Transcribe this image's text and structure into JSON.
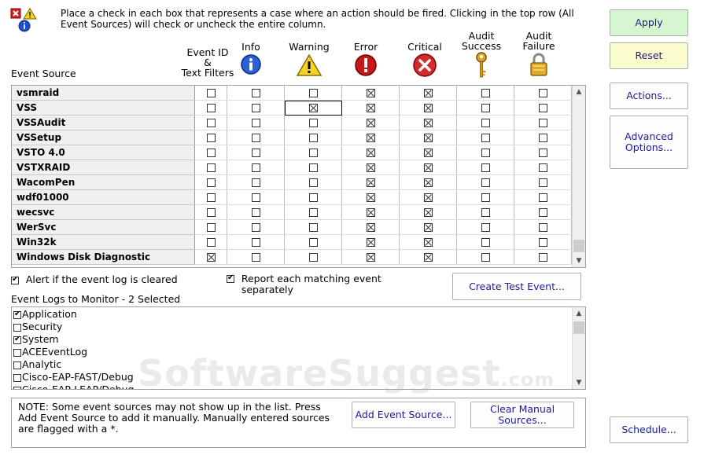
{
  "instruction": "Place a check in each box that represents a case where an action should be fired. Clicking in the top row (All Event Sources) will check or uncheck the entire column.",
  "event_source_label": "Event Source",
  "columns": [
    {
      "name": "Event ID & Text Filters",
      "line1": "Event ID",
      "line2": "&",
      "line3": "Text Filters",
      "icon": "none"
    },
    {
      "name": "Info",
      "icon": "info-icon"
    },
    {
      "name": "Warning",
      "icon": "warning-icon"
    },
    {
      "name": "Error",
      "icon": "error-icon"
    },
    {
      "name": "Critical",
      "icon": "critical-icon"
    },
    {
      "name": "Audit Success",
      "line1": "Audit",
      "line2": "Success",
      "icon": "key-icon"
    },
    {
      "name": "Audit Failure",
      "line1": "Audit",
      "line2": "Failure",
      "icon": "lock-icon"
    }
  ],
  "rows": [
    {
      "source": "vsmraid",
      "checks": [
        false,
        false,
        false,
        true,
        true,
        false,
        false
      ]
    },
    {
      "source": "VSS",
      "checks": [
        false,
        false,
        true,
        true,
        true,
        false,
        false
      ]
    },
    {
      "source": "VSSAudit",
      "checks": [
        false,
        false,
        false,
        true,
        true,
        false,
        false
      ]
    },
    {
      "source": "VSSetup",
      "checks": [
        false,
        false,
        false,
        true,
        true,
        false,
        false
      ]
    },
    {
      "source": "VSTO 4.0",
      "checks": [
        false,
        false,
        false,
        true,
        true,
        false,
        false
      ]
    },
    {
      "source": "VSTXRAID",
      "checks": [
        false,
        false,
        false,
        true,
        true,
        false,
        false
      ]
    },
    {
      "source": "WacomPen",
      "checks": [
        false,
        false,
        false,
        true,
        true,
        false,
        false
      ]
    },
    {
      "source": "wdf01000",
      "checks": [
        false,
        false,
        false,
        true,
        true,
        false,
        false
      ]
    },
    {
      "source": "wecsvc",
      "checks": [
        false,
        false,
        false,
        true,
        true,
        false,
        false
      ]
    },
    {
      "source": "WerSvc",
      "checks": [
        false,
        false,
        false,
        true,
        true,
        false,
        false
      ]
    },
    {
      "source": "Win32k",
      "checks": [
        false,
        false,
        false,
        true,
        true,
        false,
        false
      ]
    },
    {
      "source": "Windows Disk Diagnostic",
      "checks": [
        true,
        false,
        false,
        true,
        true,
        false,
        false
      ]
    }
  ],
  "alert_log_cleared": {
    "label": "Alert if the event log is cleared",
    "checked": true
  },
  "report_each": {
    "label_line1": "Report each matching event",
    "label_line2": "separately",
    "checked": true
  },
  "create_test_event": "Create Test Event...",
  "event_logs_label": "Event Logs to Monitor - 2 Selected",
  "event_logs": [
    {
      "label": "Application",
      "checked": true
    },
    {
      "label": "Security",
      "checked": false
    },
    {
      "label": "System",
      "checked": true
    },
    {
      "label": "ACEEventLog",
      "checked": false
    },
    {
      "label": "Analytic",
      "checked": false
    },
    {
      "label": "Cisco-EAP-FAST/Debug",
      "checked": false
    },
    {
      "label": "Cisco-EAP-LEAP/Debug",
      "checked": false
    }
  ],
  "note_line1": "NOTE: Some event sources may not show up in the list.  Press",
  "note_line2": "Add Event Source to add it manually.  Manually entered sources",
  "note_line3": "are flagged with a *.",
  "add_event_source": "Add Event Source...",
  "clear_manual_line1": "Clear Manual",
  "clear_manual_line2": "Sources...",
  "buttons": {
    "apply": "Apply",
    "reset": "Reset",
    "actions": "Actions...",
    "advanced_line1": "Advanced",
    "advanced_line2": "Options...",
    "schedule": "Schedule..."
  },
  "watermark": "SoftwareSuggest",
  "watermark_suffix": ".com",
  "colors": {
    "apply_bg": "#d5f7d0",
    "reset_bg": "#fbfccd",
    "link_text": "#1a1aa0"
  }
}
